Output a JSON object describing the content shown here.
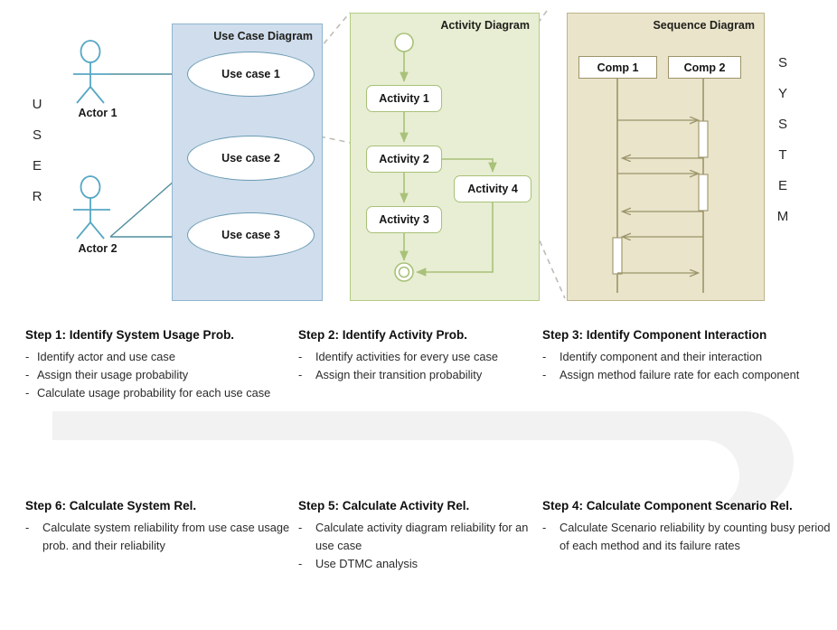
{
  "diagram": {
    "user_label_letters": [
      "U",
      "S",
      "E",
      "R"
    ],
    "system_label_letters": [
      "S",
      "Y",
      "S",
      "T",
      "E",
      "M"
    ],
    "usecase_panel": {
      "title": "Use Case Diagram",
      "fill": "#cfdded",
      "border": "#8fb4cf",
      "actors": [
        {
          "name": "Actor 1"
        },
        {
          "name": "Actor 2"
        }
      ],
      "use_cases": [
        {
          "label": "Use case 1"
        },
        {
          "label": "Use case 2"
        },
        {
          "label": "Use case 3"
        }
      ]
    },
    "activity_panel": {
      "title": "Activity Diagram",
      "fill": "#e7eed3",
      "border": "#b5cb86",
      "activities": [
        {
          "label": "Activity 1"
        },
        {
          "label": "Activity 2"
        },
        {
          "label": "Activity 3"
        },
        {
          "label": "Activity 4"
        }
      ],
      "has_initial_node": true,
      "has_final_node": true
    },
    "sequence_panel": {
      "title": "Sequence Diagram",
      "fill": "#e9e4ca",
      "border": "#bdb489",
      "components": [
        {
          "label": "Comp 1"
        },
        {
          "label": "Comp 2"
        }
      ],
      "message_count": 6
    }
  },
  "steps": {
    "top_row": [
      {
        "title": "Step 1: Identify System Usage  Prob.",
        "items": [
          "Identify actor and use case",
          "Assign their usage probability",
          "Calculate usage probability for  each use case"
        ]
      },
      {
        "title": "Step 2: Identify Activity Prob.",
        "items": [
          "Identify activities for every use case",
          "Assign their transition probability"
        ]
      },
      {
        "title": "Step 3: Identify Component Interaction",
        "items": [
          "Identify component and their interaction",
          "Assign method failure rate for each component"
        ]
      }
    ],
    "bottom_row": [
      {
        "title": "Step 6: Calculate System Rel.",
        "items": [
          "Calculate system reliability from use case usage prob. and their reliability"
        ]
      },
      {
        "title": "Step 5: Calculate Activity Rel.",
        "items": [
          "Calculate activity diagram reliability for an use case",
          "Use DTMC analysis"
        ]
      },
      {
        "title": "Step 4: Calculate Component Scenario Rel.",
        "items": [
          "Calculate Scenario reliability  by counting busy period of each method and  its failure rates"
        ]
      }
    ]
  }
}
